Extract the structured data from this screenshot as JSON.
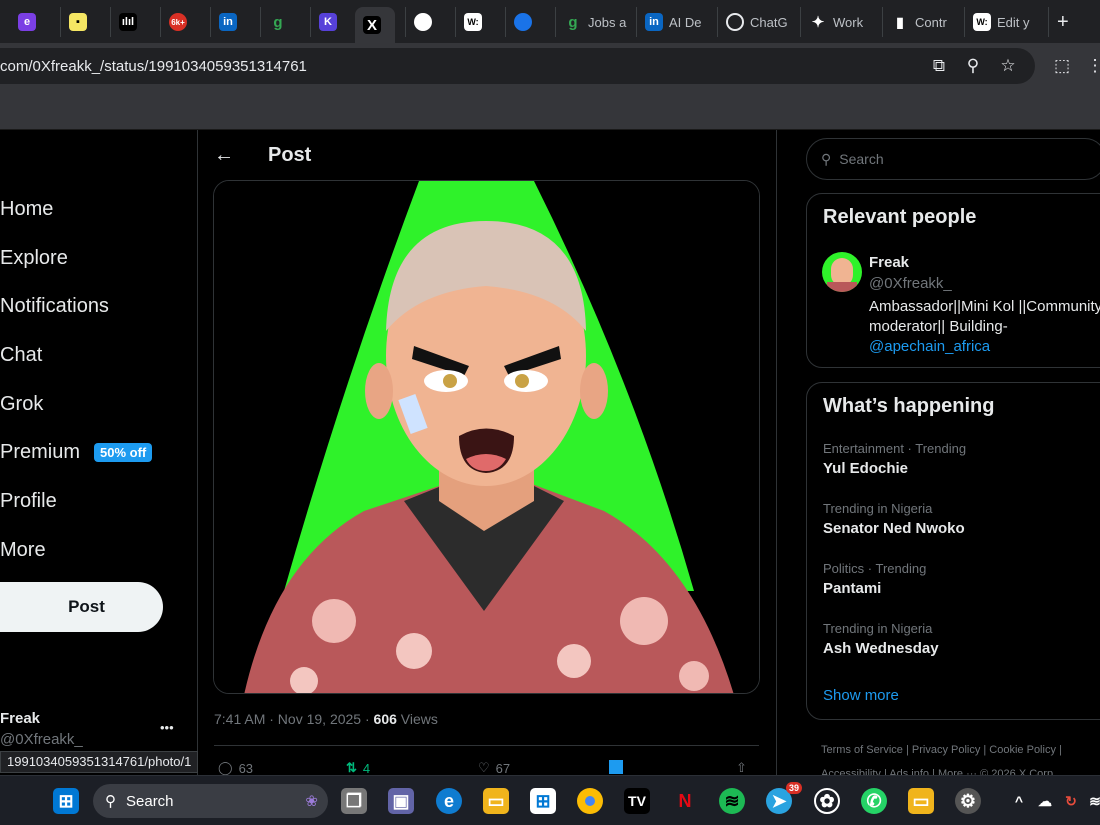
{
  "browser": {
    "tabs": [
      {
        "label": "",
        "icon": "purple-app-icon"
      },
      {
        "label": "",
        "icon": "yellow-note-icon"
      },
      {
        "label": "",
        "icon": "bars-icon"
      },
      {
        "label": "",
        "icon": "notification-6k-icon",
        "badge": "6k+"
      },
      {
        "label": "",
        "icon": "linkedin-icon",
        "glyph": "in"
      },
      {
        "label": "",
        "icon": "g-icon",
        "glyph": "g"
      },
      {
        "label": "",
        "icon": "kraken-icon",
        "glyph": "K"
      },
      {
        "label": "",
        "icon": "x-icon",
        "glyph": "X"
      },
      {
        "label": "",
        "icon": "avatar-tab-icon"
      },
      {
        "label": "",
        "icon": "w-icon",
        "glyph": "W:"
      },
      {
        "label": "",
        "icon": "blue-bird-icon"
      },
      {
        "label": "Jobs a",
        "icon": "g-icon",
        "glyph": "g"
      },
      {
        "label": "AI De",
        "icon": "linkedin-icon",
        "glyph": "in"
      },
      {
        "label": "ChatG",
        "icon": "openai-icon"
      },
      {
        "label": "Work",
        "icon": "work-icon"
      },
      {
        "label": "Contr",
        "icon": "contra-icon"
      },
      {
        "label": "Edit y",
        "icon": "w-icon",
        "glyph": "W:"
      }
    ],
    "new_tab": "+",
    "url": "com/0Xfreakk_/status/1991034059351314761",
    "status_url": "1991034059351314761/photo/1"
  },
  "nav": {
    "items": [
      "Home",
      "Explore",
      "Notifications",
      "Chat",
      "Grok",
      "Premium",
      "Profile",
      "More"
    ],
    "premium_badge": "50% off",
    "post_button": "Post",
    "account_name": "Freak",
    "account_handle": "@0Xfreakk_",
    "account_more": "•••"
  },
  "post": {
    "header_title": "Post",
    "time": "7:41 AM · Nov 19, 2025 · ",
    "views_count": "606",
    "views_label": " Views",
    "replies": "63",
    "reposts": "4",
    "likes": "67"
  },
  "right": {
    "search_placeholder": "Search",
    "relevant_title": "Relevant people",
    "person_name": "Freak",
    "person_handle": "@0Xfreakk_",
    "person_bio": "Ambassador||Mini Kol ||Community moderator|| Building-",
    "person_bio_link": "@apechain_africa",
    "happening_title": "What’s happening",
    "trends": [
      {
        "context": "Entertainment · Trending",
        "name": "Yul Edochie"
      },
      {
        "context": "Trending in Nigeria",
        "name": "Senator Ned Nwoko"
      },
      {
        "context": "Politics · Trending",
        "name": "Pantami"
      },
      {
        "context": "Trending in Nigeria",
        "name": "Ash Wednesday"
      }
    ],
    "show_more": "Show more",
    "footer_line1": "Terms of Service  |  Privacy Policy  |  Cookie Policy  |",
    "footer_line2": "Accessibility  |  Ads info  |  More ···  © 2026 X Corp."
  },
  "taskbar": {
    "search_label": "Search",
    "telegram_badge": "39"
  },
  "colors": {
    "accent": "#1d9bf0",
    "green": "#00c853",
    "like": "#f91880"
  }
}
